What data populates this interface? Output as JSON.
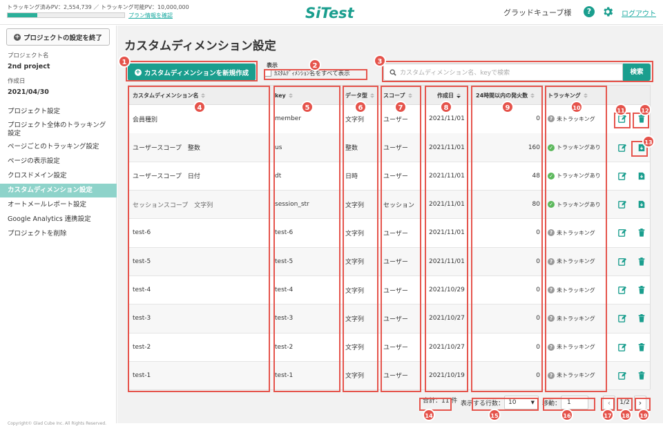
{
  "header": {
    "pv_text": "トラッキング済みPV：2,554,739 ／ トラッキング可能PV：10,000,000",
    "pv_progress": 0.255,
    "plan_link": "プラン情報を確認",
    "logo_text": "SiTest",
    "user_name": "グラッドキューブ様",
    "help_glyph": "?",
    "logout": "ログアウト",
    "accent_color": "#1a9e8e"
  },
  "sidebar": {
    "end_button": "プロジェクトの設定を終了",
    "project_label": "プロジェクト名",
    "project_name": "2nd project",
    "created_label": "作成日",
    "created_date": "2021/04/30",
    "items": [
      {
        "label": "プロジェクト設定"
      },
      {
        "label": "プロジェクト全体のトラッキング設定"
      },
      {
        "label": "ページごとのトラッキング設定"
      },
      {
        "label": "ページの表示設定"
      },
      {
        "label": "クロスドメイン設定"
      },
      {
        "label": "カスタムディメンション設定",
        "active": true
      },
      {
        "label": "オートメールレポート設定"
      },
      {
        "label": "Google Analytics 連携設定"
      },
      {
        "label": "プロジェクトを削除"
      }
    ],
    "copyright": "Copyright© Glad Cube Inc. All Rights Reserved."
  },
  "main": {
    "title": "カスタムディメンション設定",
    "create_button": "カスタムディメンションを新規作成",
    "display_label": "表示",
    "display_checkbox": "ｶｽﾀﾑﾃﾞｨﾒﾝｼｮﾝ名をすべて表示",
    "search_placeholder": "カスタムディメンション名、keyで検索",
    "search_button": "検索"
  },
  "table": {
    "headers": [
      "カスタムディメンション名",
      "key",
      "データ型",
      "スコープ",
      "作成日",
      "24時間以内の発火数",
      "トラッキング"
    ],
    "rows": [
      {
        "name": "会員種別",
        "key": "member",
        "type": "文字列",
        "scope": "ユーザー",
        "date": "2021/11/01",
        "count": "0",
        "tracking": "未トラッキング",
        "tracked": false,
        "delete": true
      },
      {
        "name": "ユーザースコープ　整数",
        "key": "us",
        "type": "整数",
        "scope": "ユーザー",
        "date": "2021/11/01",
        "count": "160",
        "tracking": "トラッキングあり",
        "tracked": true,
        "delete": false
      },
      {
        "name": "ユーザースコープ　日付",
        "key": "dt",
        "type": "日時",
        "scope": "ユーザー",
        "date": "2021/11/01",
        "count": "48",
        "tracking": "トラッキングあり",
        "tracked": true,
        "delete": false
      },
      {
        "name": "セッションスコープ　文字列",
        "key": "session_str",
        "type": "文字列",
        "scope": "セッション",
        "date": "2021/11/01",
        "count": "80",
        "tracking": "トラッキングあり",
        "tracked": true,
        "delete": false,
        "muted": true
      },
      {
        "name": "test-6",
        "key": "test-6",
        "type": "文字列",
        "scope": "ユーザー",
        "date": "2021/11/01",
        "count": "0",
        "tracking": "未トラッキング",
        "tracked": false,
        "delete": true
      },
      {
        "name": "test-5",
        "key": "test-5",
        "type": "文字列",
        "scope": "ユーザー",
        "date": "2021/11/01",
        "count": "0",
        "tracking": "未トラッキング",
        "tracked": false,
        "delete": true
      },
      {
        "name": "test-4",
        "key": "test-4",
        "type": "文字列",
        "scope": "ユーザー",
        "date": "2021/10/29",
        "count": "0",
        "tracking": "未トラッキング",
        "tracked": false,
        "delete": true
      },
      {
        "name": "test-3",
        "key": "test-3",
        "type": "文字列",
        "scope": "ユーザー",
        "date": "2021/10/27",
        "count": "0",
        "tracking": "未トラッキング",
        "tracked": false,
        "delete": true
      },
      {
        "name": "test-2",
        "key": "test-2",
        "type": "文字列",
        "scope": "ユーザー",
        "date": "2021/10/27",
        "count": "0",
        "tracking": "未トラッキング",
        "tracked": false,
        "delete": true
      },
      {
        "name": "test-1",
        "key": "test-1",
        "type": "文字列",
        "scope": "ユーザー",
        "date": "2021/10/19",
        "count": "0",
        "tracking": "未トラッキング",
        "tracked": false,
        "delete": true
      }
    ]
  },
  "pager": {
    "total": "合計：11 件",
    "rows_label": "表示する行数：",
    "rows_value": "10",
    "jump_label": "移動：",
    "jump_value": "1",
    "page_indicator": "1/2",
    "prev_glyph": "‹",
    "next_glyph": "›"
  },
  "badges": [
    "1",
    "2",
    "3",
    "4",
    "5",
    "6",
    "7",
    "8",
    "9",
    "10",
    "11",
    "12",
    "13",
    "14",
    "15",
    "16",
    "17",
    "18",
    "19"
  ],
  "highlight_color": "#e5534b"
}
